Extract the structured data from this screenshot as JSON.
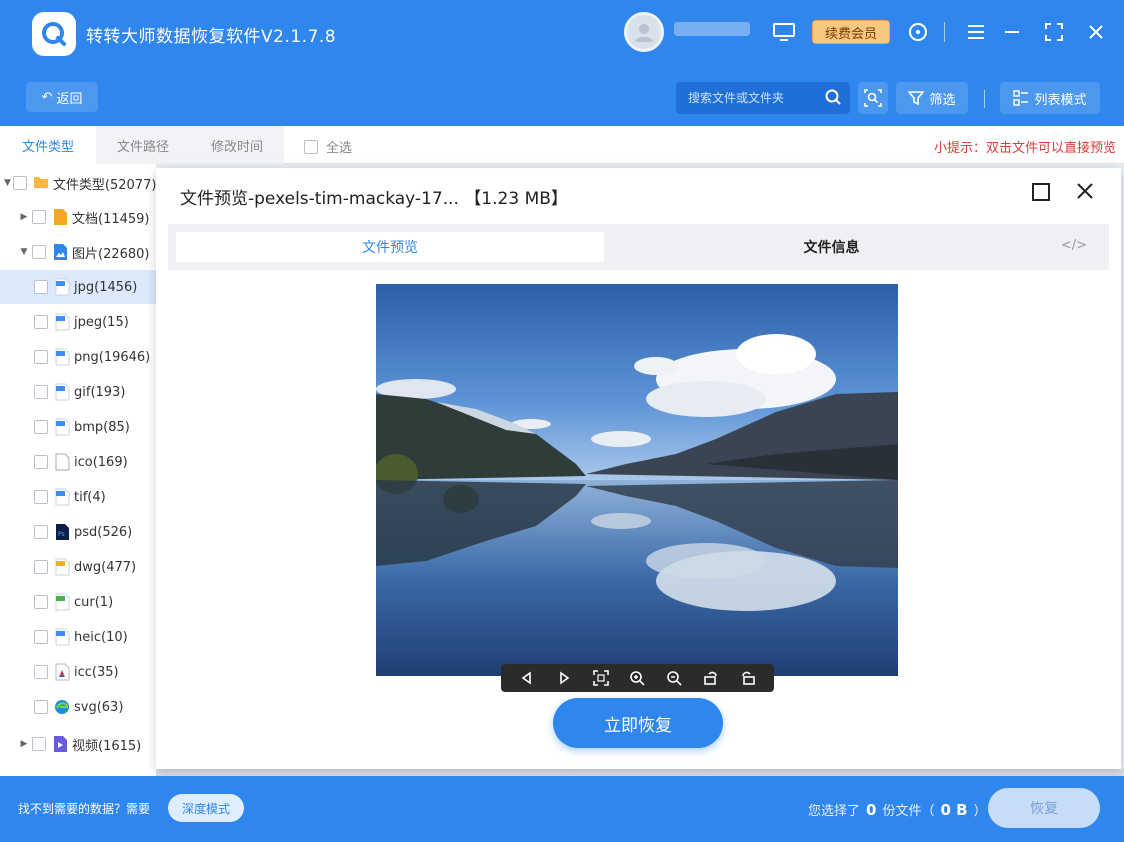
{
  "app": {
    "title": "转转大师数据恢复软件V2.1.7.8",
    "user_name": "██████",
    "vip_label": "续费会员"
  },
  "toolbar": {
    "back_label": "返回",
    "search_placeholder": "搜索文件或文件夹",
    "filter_label": "筛选",
    "view_mode_label": "列表模式"
  },
  "tabs": {
    "items": [
      {
        "label": "文件类型",
        "active": true
      },
      {
        "label": "文件路径",
        "active": false
      },
      {
        "label": "修改时间",
        "active": false
      }
    ],
    "select_all_label": "全选",
    "tip": "小提示：双击文件可以直接预览"
  },
  "tree": {
    "items": [
      {
        "label": "文件类型(52077)",
        "icon": "folder-icon",
        "level": 0,
        "arrow": "down"
      },
      {
        "label": "文档(11459)",
        "icon": "document-icon",
        "level": 1,
        "arrow": "right"
      },
      {
        "label": "图片(22680)",
        "icon": "image-icon",
        "level": 1,
        "arrow": "down"
      },
      {
        "label": "jpg(1456)",
        "icon": "image-file-icon",
        "level": 2,
        "selected": true
      },
      {
        "label": "jpeg(15)",
        "icon": "image-file-icon",
        "level": 2
      },
      {
        "label": "png(19646)",
        "icon": "image-file-icon",
        "level": 2
      },
      {
        "label": "gif(193)",
        "icon": "image-file-icon",
        "level": 2
      },
      {
        "label": "bmp(85)",
        "icon": "image-file-icon",
        "level": 2
      },
      {
        "label": "ico(169)",
        "icon": "blank-file-icon",
        "level": 2
      },
      {
        "label": "tif(4)",
        "icon": "image-file-icon",
        "level": 2
      },
      {
        "label": "psd(526)",
        "icon": "psd-file-icon",
        "level": 2
      },
      {
        "label": "dwg(477)",
        "icon": "dwg-file-icon",
        "level": 2
      },
      {
        "label": "cur(1)",
        "icon": "cur-file-icon",
        "level": 2
      },
      {
        "label": "heic(10)",
        "icon": "image-file-icon",
        "level": 2
      },
      {
        "label": "icc(35)",
        "icon": "icc-file-icon",
        "level": 2
      },
      {
        "label": "svg(63)",
        "icon": "edge-svg-icon",
        "level": 2
      },
      {
        "label": "视频(1615)",
        "icon": "video-icon",
        "level": 1,
        "arrow": "right"
      }
    ]
  },
  "modal": {
    "title": "文件预览-pexels-tim-mackay-17...",
    "size": "【1.23 MB】",
    "tab_preview": "文件预览",
    "tab_info": "文件信息",
    "code_label": "</>",
    "recover_now": "立即恢复"
  },
  "bottom": {
    "not_found": "找不到需要的数据？需要",
    "deep_mode": "深度模式",
    "selected_prefix": "您选择了",
    "selected_count": "0",
    "selected_mid": "份文件（",
    "selected_size": "0 B",
    "selected_suffix": "）",
    "recover_label": "恢复"
  },
  "colors": {
    "brand_blue": "#2f86ec",
    "vip_gold": "#f6c77e",
    "tip_red": "#e03a3a"
  }
}
